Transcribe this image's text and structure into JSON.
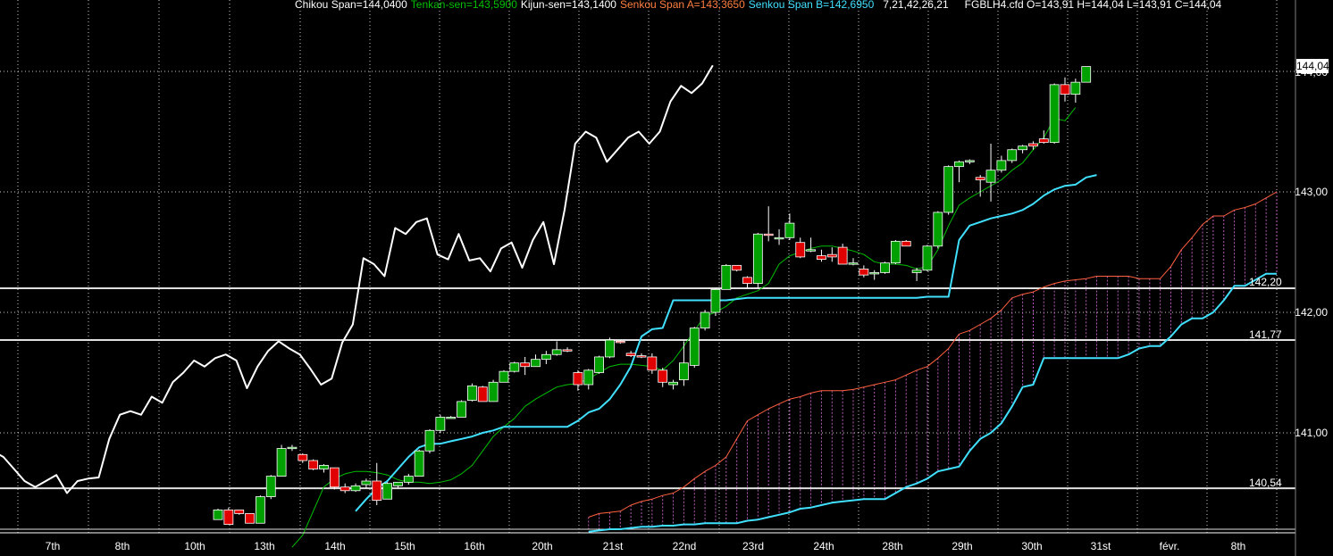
{
  "header": {
    "chikou": "Chikou Span=144,0400",
    "tenkan": "Tenkan-sen=143,5900",
    "kijun": "Kijun-sen=143,1400",
    "senkou_a": "Senkou Span A=143,3650",
    "senkou_b": "Senkou Span B=142,6950",
    "params": "7,21,42,26,21",
    "ohlc": "FGBLH4.cfd O=143,91 H=144,04 L=143,91 C=144,04"
  },
  "colors": {
    "background": "#000000",
    "grid": "#ffffff",
    "up_candle": "#00a000",
    "down_candle": "#e00000",
    "chikou": "#ffffff",
    "tenkan": "#00c000",
    "kijun": "#40e0ff",
    "senkou_a": "#ff6040",
    "senkou_b": "#40e0ff",
    "cloud_fill": "#cc66cc",
    "header_chikou": "#ffffff",
    "header_tenkan": "#00c000",
    "header_kijun": "#ffffff",
    "header_senkou_a": "#ff7f40",
    "header_senkou_b": "#40e0ff",
    "header_other": "#ffffff"
  },
  "chart_data": {
    "type": "candlestick",
    "instrument": "FGBLH4.cfd",
    "ylim": [
      140.2,
      144.3
    ],
    "y_ticks": [
      "144,00",
      "143,00",
      "142,00",
      "141,00"
    ],
    "y_tick_values": [
      144.0,
      143.0,
      142.0,
      141.0
    ],
    "x_ticks": [
      "7th",
      "8th",
      "10th",
      "13th",
      "14th",
      "15th",
      "16th",
      "20th",
      "21st",
      "22nd",
      "23rd",
      "24th",
      "28th",
      "29th",
      "30th",
      "31st",
      "févr.",
      "8th"
    ],
    "last_price_label": "144,04",
    "last_price": 144.04,
    "horizontal_levels": [
      {
        "label": "142,20",
        "value": 142.2
      },
      {
        "label": "141,77",
        "value": 141.77
      },
      {
        "label": "140,54",
        "value": 140.54
      }
    ],
    "grid": true,
    "candles_ohlc": [
      [
        140.28,
        140.37,
        140.28,
        140.36
      ],
      [
        140.36,
        140.38,
        140.24,
        140.24
      ],
      [
        140.36,
        140.36,
        140.32,
        140.33
      ],
      [
        140.33,
        140.33,
        140.25,
        140.25
      ],
      [
        140.25,
        140.48,
        140.25,
        140.47
      ],
      [
        140.47,
        140.65,
        140.45,
        140.64
      ],
      [
        140.64,
        140.9,
        140.64,
        140.87
      ],
      [
        140.87,
        140.9,
        140.85,
        140.88
      ],
      [
        140.82,
        140.83,
        140.75,
        140.77
      ],
      [
        140.77,
        140.78,
        140.69,
        140.7
      ],
      [
        140.7,
        140.74,
        140.67,
        140.73
      ],
      [
        140.71,
        140.71,
        140.53,
        140.55
      ],
      [
        140.55,
        140.58,
        140.5,
        140.52
      ],
      [
        140.52,
        140.58,
        140.51,
        140.56
      ],
      [
        140.57,
        140.62,
        140.54,
        140.6
      ],
      [
        140.6,
        140.75,
        140.4,
        140.44
      ],
      [
        140.45,
        140.59,
        140.45,
        140.58
      ],
      [
        140.56,
        140.59,
        140.54,
        140.59
      ],
      [
        140.59,
        140.66,
        140.57,
        140.64
      ],
      [
        140.64,
        140.86,
        140.64,
        140.85
      ],
      [
        140.85,
        141.03,
        140.83,
        141.02
      ],
      [
        141.02,
        141.15,
        141.0,
        141.13
      ],
      [
        141.13,
        141.14,
        141.12,
        141.13
      ],
      [
        141.13,
        141.27,
        141.13,
        141.26
      ],
      [
        141.27,
        141.41,
        141.26,
        141.39
      ],
      [
        141.38,
        141.39,
        141.26,
        141.26
      ],
      [
        141.26,
        141.44,
        141.26,
        141.42
      ],
      [
        141.42,
        141.52,
        141.42,
        141.51
      ],
      [
        141.51,
        141.59,
        141.5,
        141.58
      ],
      [
        141.58,
        141.63,
        141.48,
        141.55
      ],
      [
        141.55,
        141.65,
        141.55,
        141.61
      ],
      [
        141.61,
        141.68,
        141.57,
        141.65
      ],
      [
        141.65,
        141.76,
        141.64,
        141.69
      ],
      [
        141.69,
        141.71,
        141.67,
        141.68
      ],
      [
        141.5,
        141.52,
        141.35,
        141.4
      ],
      [
        141.4,
        141.53,
        141.36,
        141.52
      ],
      [
        141.5,
        141.64,
        141.49,
        141.63
      ],
      [
        141.63,
        141.79,
        141.62,
        141.77
      ],
      [
        141.76,
        141.77,
        141.74,
        141.75
      ],
      [
        141.66,
        141.68,
        141.63,
        141.64
      ],
      [
        141.64,
        141.66,
        141.62,
        141.63
      ],
      [
        141.63,
        141.66,
        141.49,
        141.52
      ],
      [
        141.52,
        141.54,
        141.38,
        141.42
      ],
      [
        141.4,
        141.44,
        141.36,
        141.42
      ],
      [
        141.44,
        141.76,
        141.39,
        141.58
      ],
      [
        141.56,
        141.88,
        141.54,
        141.87
      ],
      [
        141.87,
        142.02,
        141.85,
        142.0
      ],
      [
        142.0,
        142.2,
        141.97,
        142.19
      ],
      [
        142.19,
        142.4,
        142.19,
        142.39
      ],
      [
        142.39,
        142.38,
        142.34,
        142.35
      ],
      [
        142.29,
        142.3,
        142.2,
        142.24
      ],
      [
        142.24,
        142.66,
        142.2,
        142.65
      ],
      [
        142.65,
        142.88,
        142.59,
        142.64
      ],
      [
        142.61,
        142.69,
        142.56,
        142.62
      ],
      [
        142.62,
        142.82,
        142.6,
        142.74
      ],
      [
        142.58,
        142.62,
        142.45,
        142.46
      ],
      [
        142.52,
        142.62,
        142.5,
        142.52
      ],
      [
        142.47,
        142.52,
        142.42,
        142.44
      ],
      [
        142.48,
        142.54,
        142.42,
        142.46
      ],
      [
        142.54,
        142.57,
        142.4,
        142.4
      ],
      [
        142.4,
        142.45,
        142.39,
        142.41
      ],
      [
        142.36,
        142.39,
        142.29,
        142.31
      ],
      [
        142.32,
        142.35,
        142.27,
        142.33
      ],
      [
        142.33,
        142.42,
        142.32,
        142.41
      ],
      [
        142.41,
        142.6,
        142.4,
        142.59
      ],
      [
        142.59,
        142.6,
        142.55,
        142.55
      ],
      [
        142.33,
        142.37,
        142.26,
        142.35
      ],
      [
        142.35,
        142.56,
        142.34,
        142.55
      ],
      [
        142.55,
        142.84,
        142.53,
        142.83
      ],
      [
        142.83,
        143.22,
        142.81,
        143.21
      ],
      [
        143.21,
        143.26,
        143.08,
        143.25
      ],
      [
        143.25,
        143.27,
        143.23,
        143.26
      ],
      [
        143.12,
        143.14,
        142.96,
        143.1
      ],
      [
        143.08,
        143.4,
        142.92,
        143.18
      ],
      [
        143.18,
        143.3,
        143.16,
        143.26
      ],
      [
        143.26,
        143.36,
        143.24,
        143.35
      ],
      [
        143.35,
        143.39,
        143.32,
        143.38
      ],
      [
        143.4,
        143.42,
        143.35,
        143.38
      ],
      [
        143.44,
        143.51,
        143.4,
        143.41
      ],
      [
        143.41,
        143.9,
        143.4,
        143.89
      ],
      [
        143.89,
        143.95,
        143.75,
        143.81
      ],
      [
        143.81,
        143.94,
        143.74,
        143.91
      ],
      [
        143.91,
        144.04,
        143.91,
        144.04
      ]
    ],
    "tenkan_sen": [
      140.05,
      140.15,
      140.35,
      140.55,
      140.62,
      140.66,
      140.68,
      140.68,
      140.67,
      140.65,
      140.61,
      140.59,
      140.59,
      140.58,
      140.59,
      140.61,
      140.66,
      140.73,
      140.85,
      140.97,
      141.05,
      141.12,
      141.22,
      141.28,
      141.33,
      141.38,
      141.4,
      141.41,
      141.45,
      141.5,
      141.55,
      141.57,
      141.57,
      141.56,
      141.55,
      141.52,
      141.6,
      141.72,
      141.85,
      141.97,
      142.0,
      142.05,
      142.12,
      142.15,
      142.18,
      142.24,
      142.4,
      142.47,
      142.5,
      142.53,
      142.55,
      142.55,
      142.53,
      142.51,
      142.48,
      142.42,
      142.4,
      142.4,
      142.39,
      142.36,
      142.38,
      142.52,
      142.72,
      142.89,
      142.95,
      143.0,
      143.05,
      143.1,
      143.18,
      143.24,
      143.35,
      143.45,
      143.61,
      143.59,
      143.7
    ],
    "tenkan_start_bar": 7,
    "kijun_sen": [
      140.35,
      140.45,
      140.54,
      140.6,
      140.7,
      140.8,
      140.88,
      140.91,
      140.91,
      140.93,
      140.95,
      140.97,
      141.0,
      141.02,
      141.05,
      141.05,
      141.05,
      141.05,
      141.05,
      141.05,
      141.05,
      141.1,
      141.17,
      141.2,
      141.28,
      141.4,
      141.55,
      141.8,
      141.86,
      141.87,
      142.1,
      142.1,
      142.1,
      142.1,
      142.1,
      142.1,
      142.11,
      142.12,
      142.12,
      142.12,
      142.12,
      142.12,
      142.12,
      142.12,
      142.12,
      142.12,
      142.12,
      142.12,
      142.12,
      142.12,
      142.12,
      142.12,
      142.12,
      142.12,
      142.13,
      142.13,
      142.13,
      142.6,
      142.72,
      142.75,
      142.78,
      142.8,
      142.82,
      142.85,
      142.9,
      142.97,
      143.02,
      143.05,
      143.06,
      143.12,
      143.14
    ],
    "kijun_start_bar": 13,
    "chikou_span": [
      140.85,
      140.8,
      140.7,
      140.6,
      140.55,
      140.6,
      140.65,
      140.5,
      140.6,
      140.62,
      140.63,
      140.95,
      141.15,
      141.18,
      141.15,
      141.3,
      141.25,
      141.42,
      141.5,
      141.6,
      141.55,
      141.62,
      141.65,
      141.6,
      141.37,
      141.55,
      141.68,
      141.76,
      141.7,
      141.65,
      141.53,
      141.4,
      141.45,
      141.75,
      141.9,
      142.45,
      142.4,
      142.3,
      142.7,
      142.65,
      142.75,
      142.78,
      142.48,
      142.44,
      142.65,
      142.43,
      142.45,
      142.34,
      142.53,
      142.58,
      142.37,
      142.6,
      142.75,
      142.4,
      142.85,
      143.4,
      143.5,
      143.45,
      143.25,
      143.35,
      143.45,
      143.5,
      143.4,
      143.5,
      143.75,
      143.88,
      143.82,
      143.9,
      144.05
    ],
    "senkou_span_a": [
      140.3,
      140.33,
      140.34,
      140.35,
      140.4,
      140.43,
      140.45,
      140.48,
      140.5,
      140.55,
      140.62,
      140.68,
      140.73,
      140.8,
      140.95,
      141.1,
      141.15,
      141.2,
      141.24,
      141.28,
      141.3,
      141.33,
      141.35,
      141.35,
      141.35,
      141.36,
      141.38,
      141.4,
      141.42,
      141.44,
      141.48,
      141.52,
      141.55,
      141.62,
      141.7,
      141.82,
      141.85,
      141.9,
      141.95,
      142.02,
      142.12,
      142.15,
      142.17,
      142.21,
      142.24,
      142.26,
      142.27,
      142.28,
      142.3,
      142.3,
      142.3,
      142.3,
      142.28,
      142.28,
      142.28,
      142.38,
      142.52,
      142.62,
      142.73,
      142.8,
      142.8,
      142.85,
      142.87,
      142.9,
      142.95,
      143.0
    ],
    "senkou_span_b": [
      140.18,
      140.19,
      140.2,
      140.2,
      140.21,
      140.22,
      140.22,
      140.23,
      140.23,
      140.24,
      140.24,
      140.25,
      140.25,
      140.25,
      140.25,
      140.27,
      140.28,
      140.3,
      140.32,
      140.34,
      140.37,
      140.38,
      140.4,
      140.42,
      140.43,
      140.44,
      140.45,
      140.45,
      140.45,
      140.5,
      140.55,
      140.58,
      140.62,
      140.68,
      140.7,
      140.72,
      140.85,
      140.95,
      141.0,
      141.08,
      141.22,
      141.38,
      141.4,
      141.62,
      141.62,
      141.62,
      141.62,
      141.62,
      141.62,
      141.62,
      141.62,
      141.65,
      141.7,
      141.72,
      141.72,
      141.8,
      141.9,
      141.95,
      141.95,
      142.0,
      142.1,
      142.22,
      142.22,
      142.27,
      142.32,
      142.32
    ],
    "senkou_start_bar": 41
  }
}
